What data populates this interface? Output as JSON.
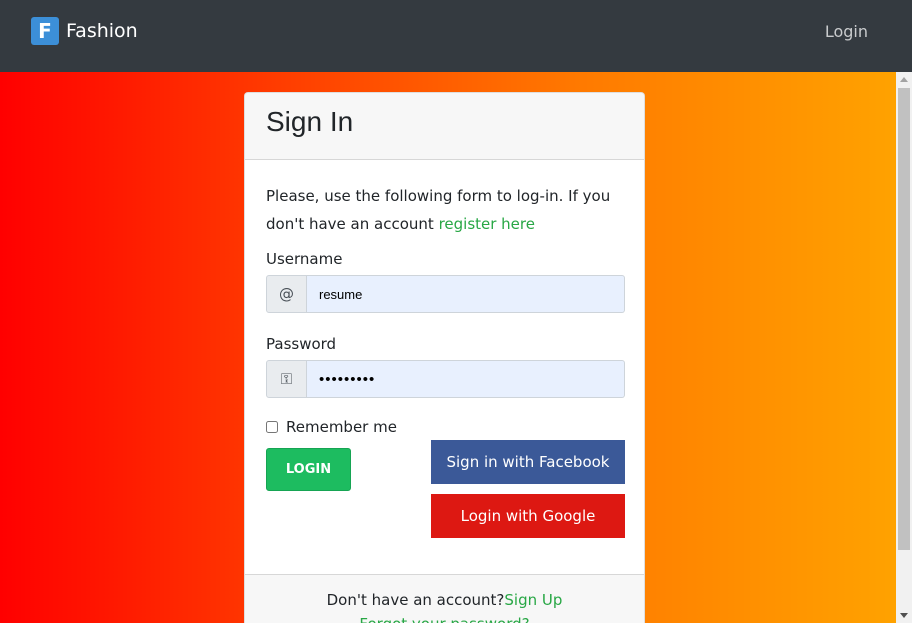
{
  "nav": {
    "brand_letter": "F",
    "brand_name": "Fashion",
    "login_link": "Login"
  },
  "card": {
    "title": "Sign In",
    "intro_text": "Please, use the following form to log-in. If you don't have an account",
    "register_link": "register here",
    "username_label": "Username",
    "username_addon": "@",
    "username_value": "resume",
    "password_label": "Password",
    "password_addon": "⚿",
    "password_value": "•••••••••",
    "remember_label": "Remember me",
    "login_button": "LOGIN",
    "facebook_button": "Sign in with Facebook",
    "google_button": "Login with Google",
    "footer_text": "Don't have an account?",
    "signup_link": "Sign Up",
    "forgot_link": "Forgot your password?"
  },
  "colors": {
    "navbar_bg": "#343a40",
    "accent_green": "#28a745",
    "login_button": "#1dbc60",
    "facebook": "#3b5998",
    "google": "#dd1812"
  }
}
